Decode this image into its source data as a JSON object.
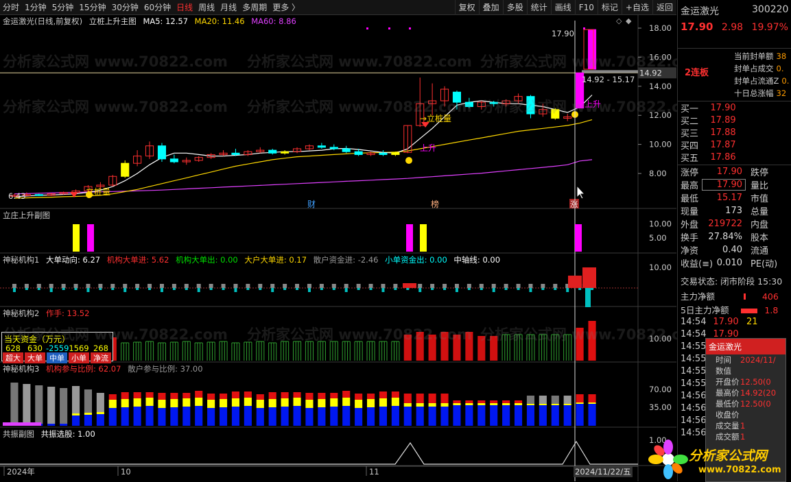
{
  "toolbar": {
    "periods": [
      "分时",
      "1分钟",
      "5分钟",
      "15分钟",
      "30分钟",
      "60分钟",
      "日线",
      "周线",
      "月线",
      "多周期",
      "更多 〉"
    ],
    "active_period": "日线",
    "tools": [
      "复权",
      "叠加",
      "多股",
      "统计",
      "画线",
      "F10",
      "标记",
      "+自选",
      "返回"
    ]
  },
  "main_title": {
    "stock": "金运激光(日线,前复权)",
    "indicator": "立桩上升主图",
    "ma5": "MA5: 12.57",
    "ma20": "MA20: 11.46",
    "ma60": "MA60: 8.86"
  },
  "annotations": {
    "high": "17.90",
    "range": "14.92 - 15.17",
    "low": "6.43",
    "current_line": "14.92",
    "rise": "上升",
    "stake": "立桩量",
    "stake_arrow": "→立桩量",
    "marker_cai": "财",
    "marker_bang": "榜",
    "marker_zhang": "涨"
  },
  "panels": {
    "sub1": "立庄上升副图",
    "sub2": {
      "name": "神秘机构1",
      "items": [
        "大单动向: 6.27",
        "机构大单进: 5.62",
        "机构大单出: 0.00",
        "大户大单进: 0.17",
        "散户资金进: -2.46",
        "小单资金出: 0.00",
        "中轴线: 0.00"
      ]
    },
    "sub3": {
      "name": "神秘机构2",
      "zuoshou": "作手: 13.52"
    },
    "sub4": {
      "name": "神秘机构3",
      "items": [
        "机构参与比例: 62.07",
        "散户参与比例: 37.00"
      ]
    },
    "sub5": {
      "name": "共振副图",
      "items": [
        "共振选股: 1.00"
      ]
    }
  },
  "fund_box": {
    "title": "当天资金（万元）",
    "values": [
      "628",
      "630",
      "-2559",
      "1569",
      "268"
    ],
    "tags": [
      "超大",
      "大单",
      "中单",
      "小单",
      "净流"
    ]
  },
  "axis": {
    "main": [
      "18.00",
      "16.00",
      "14.00",
      "12.00",
      "10.00",
      "8.00"
    ],
    "sub1": [
      "10.00",
      "5.00"
    ],
    "sub2": [
      "10.00"
    ],
    "sub3": [
      "10.00"
    ],
    "sub4": [
      "70.00",
      "35.00"
    ],
    "sub5": [
      "1.00"
    ],
    "xdates": [
      "2024年",
      "10",
      "11",
      "2024/11/22/五"
    ]
  },
  "quote": {
    "name": "金运激光",
    "code": "300220",
    "price": "17.90",
    "change": "2.98",
    "pct": "19.97%",
    "board": "2连板",
    "seal": [
      {
        "k": "当前封单额",
        "v": "38"
      },
      {
        "k": "封单占成交",
        "v": "0."
      },
      {
        "k": "封单占流通Z",
        "v": "0."
      },
      {
        "k": "十日总涨幅",
        "v": "32"
      }
    ],
    "buys": [
      {
        "k": "买一",
        "v": "17.90"
      },
      {
        "k": "买二",
        "v": "17.89"
      },
      {
        "k": "买三",
        "v": "17.88"
      },
      {
        "k": "买四",
        "v": "17.87"
      },
      {
        "k": "买五",
        "v": "17.86"
      }
    ],
    "stats": [
      {
        "k": "涨停",
        "v": "17.90",
        "c": "red",
        "k2": "跌停"
      },
      {
        "k": "最高",
        "v": "17.90",
        "c": "red",
        "k2": "量比"
      },
      {
        "k": "最低",
        "v": "15.17",
        "c": "red",
        "k2": "市值"
      },
      {
        "k": "现量",
        "v": "173",
        "c": "wht",
        "k2": "总量"
      },
      {
        "k": "外盘",
        "v": "219722",
        "c": "red",
        "k2": "内盘"
      },
      {
        "k": "换手",
        "v": "27.84%",
        "c": "wht",
        "k2": "股本"
      },
      {
        "k": "净资",
        "v": "0.40",
        "c": "wht",
        "k2": "流通"
      },
      {
        "k": "收益(≡)",
        "v": "0.010",
        "c": "wht",
        "k2": "PE(动)"
      }
    ],
    "trade_state": "交易状态: 闭市阶段 15:30",
    "flow1": {
      "k": "主力净额",
      "v": "406"
    },
    "flow2": {
      "k": "5日主力净额",
      "v": "1.8"
    },
    "ticks": [
      {
        "t": "14:54",
        "p": "17.90",
        "v": "21"
      },
      {
        "t": "14:54",
        "p": "17.90",
        "v": ""
      },
      {
        "t": "14:55",
        "p": "",
        "v": ""
      },
      {
        "t": "14:55",
        "p": "",
        "v": ""
      },
      {
        "t": "14:55",
        "p": "",
        "v": ""
      },
      {
        "t": "14:55",
        "p": "",
        "v": ""
      },
      {
        "t": "14:56",
        "p": "",
        "v": ""
      },
      {
        "t": "14:56",
        "p": "",
        "v": ""
      },
      {
        "t": "14:56",
        "p": "",
        "v": ""
      },
      {
        "t": "14:56",
        "p": "",
        "v": ""
      }
    ]
  },
  "popup": {
    "title": "金运激光",
    "rows": [
      {
        "k": "时间",
        "v": "2024/11/"
      },
      {
        "k": "数值",
        "v": ""
      },
      {
        "k": "开盘价",
        "v": "12.50(0"
      },
      {
        "k": "最高价",
        "v": "14.92(20"
      },
      {
        "k": "最低价",
        "v": "12.50(0"
      },
      {
        "k": "收盘价",
        "v": ""
      },
      {
        "k": "成交量",
        "v": "1"
      },
      {
        "k": "成交额",
        "v": "1"
      }
    ]
  },
  "watermark": {
    "text": "分析家公式网",
    "url": "www.70822.com",
    "bg": "分析家公式网 www.70822.com"
  },
  "colors": {
    "up": "#ff3030",
    "down": "#00ffff",
    "ma5": "#ffffff",
    "ma20": "#ffd800",
    "ma60": "#e040ff",
    "magenta": "#ff00ff",
    "yellow": "#ffff00"
  },
  "chart_data": {
    "type": "candlestick",
    "price_axis": [
      8,
      18
    ],
    "candles": [
      {
        "o": 6.43,
        "h": 6.6,
        "l": 6.4,
        "c": 6.5
      },
      {
        "o": 6.5,
        "h": 6.7,
        "l": 6.45,
        "c": 6.55
      },
      {
        "o": 6.55,
        "h": 6.6,
        "l": 6.45,
        "c": 6.5
      },
      {
        "o": 6.5,
        "h": 6.65,
        "l": 6.45,
        "c": 6.6
      },
      {
        "o": 6.6,
        "h": 6.75,
        "l": 6.55,
        "c": 6.7
      },
      {
        "o": 6.7,
        "h": 6.9,
        "l": 6.6,
        "c": 6.8
      },
      {
        "o": 6.8,
        "h": 7.2,
        "l": 6.7,
        "c": 7.1
      },
      {
        "o": 7.1,
        "h": 7.4,
        "l": 6.9,
        "c": 7.2
      },
      {
        "o": 7.2,
        "h": 7.9,
        "l": 7.1,
        "c": 7.8
      },
      {
        "o": 7.8,
        "h": 8.9,
        "l": 7.7,
        "c": 8.7
      },
      {
        "o": 8.7,
        "h": 9.6,
        "l": 8.5,
        "c": 9.2
      },
      {
        "o": 9.2,
        "h": 10.2,
        "l": 9.0,
        "c": 9.9
      },
      {
        "o": 9.9,
        "h": 10.1,
        "l": 8.8,
        "c": 9.0
      },
      {
        "o": 9.0,
        "h": 9.3,
        "l": 8.7,
        "c": 8.8
      },
      {
        "o": 8.8,
        "h": 9.1,
        "l": 8.6,
        "c": 8.9
      },
      {
        "o": 8.9,
        "h": 9.2,
        "l": 8.8,
        "c": 9.1
      },
      {
        "o": 9.1,
        "h": 9.4,
        "l": 9.0,
        "c": 9.3
      },
      {
        "o": 9.3,
        "h": 9.6,
        "l": 9.2,
        "c": 9.4
      },
      {
        "o": 9.4,
        "h": 9.7,
        "l": 9.2,
        "c": 9.3
      },
      {
        "o": 9.3,
        "h": 9.6,
        "l": 9.2,
        "c": 9.5
      },
      {
        "o": 9.5,
        "h": 9.8,
        "l": 9.4,
        "c": 9.6
      },
      {
        "o": 9.6,
        "h": 9.7,
        "l": 9.3,
        "c": 9.4
      },
      {
        "o": 9.4,
        "h": 9.6,
        "l": 9.3,
        "c": 9.5
      },
      {
        "o": 9.5,
        "h": 9.8,
        "l": 9.4,
        "c": 9.7
      },
      {
        "o": 9.7,
        "h": 10.0,
        "l": 9.6,
        "c": 9.9
      },
      {
        "o": 9.9,
        "h": 10.1,
        "l": 9.7,
        "c": 9.8
      },
      {
        "o": 9.8,
        "h": 10.0,
        "l": 9.6,
        "c": 9.7
      },
      {
        "o": 9.7,
        "h": 9.9,
        "l": 9.4,
        "c": 9.5
      },
      {
        "o": 9.5,
        "h": 9.7,
        "l": 9.2,
        "c": 9.3
      },
      {
        "o": 9.3,
        "h": 9.5,
        "l": 9.2,
        "c": 9.4
      },
      {
        "o": 9.4,
        "h": 9.6,
        "l": 9.2,
        "c": 9.3
      },
      {
        "o": 9.3,
        "h": 9.5,
        "l": 9.2,
        "c": 9.45
      },
      {
        "o": 9.45,
        "h": 11.3,
        "l": 9.4,
        "c": 11.3
      },
      {
        "o": 11.3,
        "h": 14.6,
        "l": 11.2,
        "c": 12.8
      },
      {
        "o": 12.8,
        "h": 14.2,
        "l": 12.0,
        "c": 13.0
      },
      {
        "o": 13.0,
        "h": 14.0,
        "l": 12.6,
        "c": 13.8
      },
      {
        "o": 13.6,
        "h": 13.7,
        "l": 12.4,
        "c": 12.9
      },
      {
        "o": 12.9,
        "h": 13.2,
        "l": 12.5,
        "c": 12.6
      },
      {
        "o": 12.6,
        "h": 13.0,
        "l": 12.4,
        "c": 12.9
      },
      {
        "o": 12.9,
        "h": 13.0,
        "l": 12.6,
        "c": 12.8
      },
      {
        "o": 12.8,
        "h": 13.1,
        "l": 12.6,
        "c": 13.0
      },
      {
        "o": 13.0,
        "h": 13.5,
        "l": 12.8,
        "c": 13.3
      },
      {
        "o": 13.3,
        "h": 13.4,
        "l": 11.8,
        "c": 12.1
      },
      {
        "o": 12.1,
        "h": 12.8,
        "l": 11.9,
        "c": 12.4
      },
      {
        "o": 12.4,
        "h": 12.5,
        "l": 11.7,
        "c": 11.8
      },
      {
        "o": 11.8,
        "h": 12.1,
        "l": 11.6,
        "c": 11.9
      },
      {
        "o": 12.5,
        "h": 14.92,
        "l": 12.5,
        "c": 14.92
      },
      {
        "o": 15.17,
        "h": 17.9,
        "l": 15.17,
        "c": 17.9
      }
    ],
    "ma5": [
      6.4,
      6.45,
      6.5,
      6.52,
      6.56,
      6.6,
      6.7,
      6.85,
      7.1,
      7.5,
      8.0,
      8.6,
      9.1,
      9.4,
      9.4,
      9.3,
      9.2,
      9.2,
      9.25,
      9.3,
      9.4,
      9.45,
      9.5,
      9.5,
      9.55,
      9.6,
      9.7,
      9.72,
      9.65,
      9.55,
      9.45,
      9.4,
      9.7,
      10.4,
      11.1,
      11.9,
      12.7,
      12.9,
      13.0,
      12.9,
      12.8,
      12.8,
      12.7,
      12.6,
      12.4,
      12.2,
      12.57,
      13.4
    ],
    "ma20": [
      6.3,
      6.32,
      6.35,
      6.37,
      6.4,
      6.42,
      6.45,
      6.5,
      6.6,
      6.75,
      6.9,
      7.1,
      7.3,
      7.5,
      7.7,
      7.9,
      8.1,
      8.3,
      8.5,
      8.65,
      8.8,
      8.95,
      9.05,
      9.15,
      9.2,
      9.25,
      9.3,
      9.35,
      9.4,
      9.42,
      9.45,
      9.47,
      9.55,
      9.7,
      9.85,
      10.0,
      10.15,
      10.3,
      10.45,
      10.6,
      10.75,
      10.9,
      11.0,
      11.1,
      11.2,
      11.3,
      11.46,
      11.7
    ],
    "ma60": [
      6.6,
      6.62,
      6.64,
      6.66,
      6.68,
      6.7,
      6.72,
      6.74,
      6.76,
      6.78,
      6.8,
      6.83,
      6.86,
      6.9,
      6.94,
      6.98,
      7.02,
      7.06,
      7.1,
      7.14,
      7.18,
      7.22,
      7.26,
      7.3,
      7.34,
      7.38,
      7.42,
      7.46,
      7.5,
      7.54,
      7.58,
      7.62,
      7.66,
      7.72,
      7.78,
      7.84,
      7.9,
      7.96,
      8.02,
      8.1,
      8.18,
      8.26,
      8.34,
      8.42,
      8.5,
      8.6,
      8.86,
      8.95
    ]
  }
}
